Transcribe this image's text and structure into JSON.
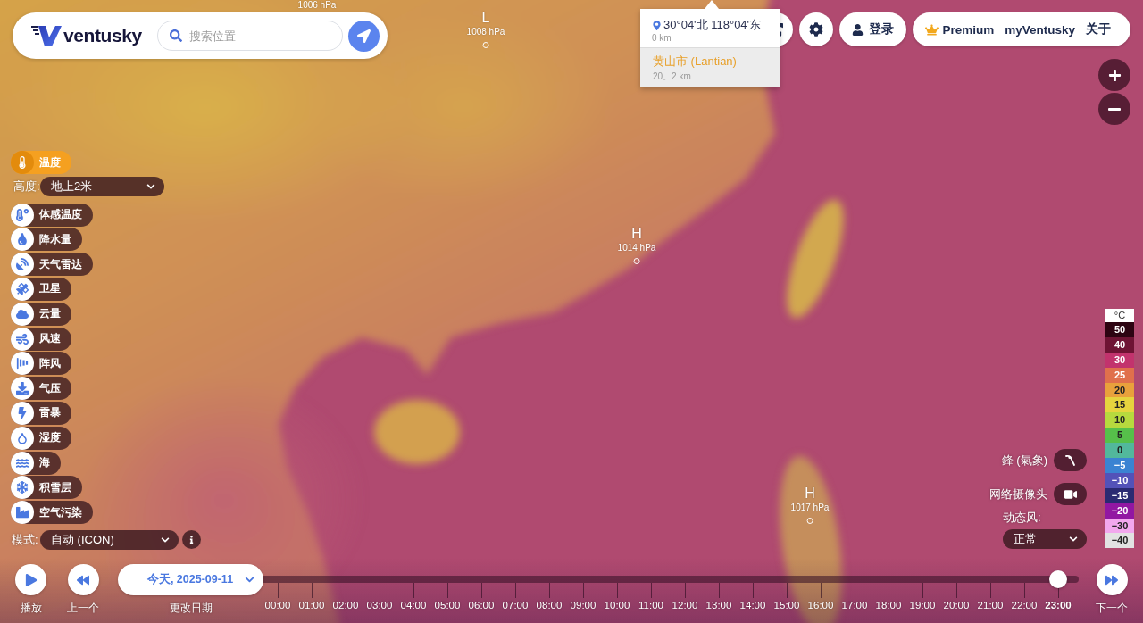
{
  "header": {
    "logo": "ventusky",
    "search": {
      "placeholder": "搜索位置"
    }
  },
  "location_popup": {
    "coordinates": "30°04'北 118°04'东",
    "elevation": "0 km",
    "place": "黄山市 (Lantian)",
    "place_detail": "20。2 km"
  },
  "account": {
    "login": "登录",
    "links": [
      "Premium",
      "myVentusky",
      "关于"
    ]
  },
  "pressure_centers": [
    {
      "reading": "1006 hPa"
    },
    {
      "letter": "L",
      "reading": "1008 hPa"
    },
    {
      "letter": "H",
      "reading": "1014 hPa"
    },
    {
      "letter": "H",
      "reading": "1017 hPa"
    }
  ],
  "layers": [
    {
      "label": "温度",
      "selected": true
    },
    {
      "label": "体感温度",
      "selected": false
    },
    {
      "label": "降水量",
      "selected": false
    },
    {
      "label": "天气雷达",
      "selected": false
    },
    {
      "label": "卫星",
      "selected": false
    },
    {
      "label": "云量",
      "selected": false
    },
    {
      "label": "风速",
      "selected": false
    },
    {
      "label": "阵风",
      "selected": false
    },
    {
      "label": "气压",
      "selected": false
    },
    {
      "label": "雷暴",
      "selected": false
    },
    {
      "label": "湿度",
      "selected": false
    },
    {
      "label": "海",
      "selected": false
    },
    {
      "label": "积雪层",
      "selected": false
    },
    {
      "label": "空气污染",
      "selected": false
    }
  ],
  "layer_options": {
    "label": "高度:",
    "value": "地上2米"
  },
  "model": {
    "label": "模式:",
    "value": "自动 (ICON)"
  },
  "overlays": [
    {
      "kind": "fronts",
      "label": "鋒 (氣象)"
    },
    {
      "kind": "webcam",
      "label": "网络摄像头"
    }
  ],
  "animated_wind": {
    "label": "动态风:",
    "value": "正常"
  },
  "legend": {
    "unit": "°C",
    "steps": [
      {
        "label": "50",
        "color": "#2d0412"
      },
      {
        "label": "40",
        "color": "#6e1434"
      },
      {
        "label": "30",
        "color": "#c2336d"
      },
      {
        "label": "25",
        "color": "#e0704c"
      },
      {
        "label": "20",
        "color": "#e9a13c"
      },
      {
        "label": "15",
        "color": "#e6d43e"
      },
      {
        "label": "10",
        "color": "#b7d93e"
      },
      {
        "label": "5",
        "color": "#56c04a"
      },
      {
        "label": "0",
        "color": "#52b89c"
      },
      {
        "label": "−5",
        "color": "#3b83d2"
      },
      {
        "label": "−10",
        "color": "#5352b8"
      },
      {
        "label": "−15",
        "color": "#2a2a72"
      },
      {
        "label": "−20",
        "color": "#9217a2"
      },
      {
        "label": "−30",
        "color": "#f2a8ee"
      },
      {
        "label": "−40",
        "color": "#e2e2e2"
      }
    ]
  },
  "timeline": {
    "play": "播放",
    "previous": "上一个",
    "date": "今天, 2025-09-11",
    "date_caption": "更改日期",
    "next": "下一个",
    "hours": [
      {
        "label": "00:00",
        "selected": false
      },
      {
        "label": "01:00",
        "selected": false
      },
      {
        "label": "02:00",
        "selected": false
      },
      {
        "label": "03:00",
        "selected": false
      },
      {
        "label": "04:00",
        "selected": false
      },
      {
        "label": "05:00",
        "selected": false
      },
      {
        "label": "06:00",
        "selected": false
      },
      {
        "label": "07:00",
        "selected": false
      },
      {
        "label": "08:00",
        "selected": false
      },
      {
        "label": "09:00",
        "selected": false
      },
      {
        "label": "10:00",
        "selected": false
      },
      {
        "label": "11:00",
        "selected": false
      },
      {
        "label": "12:00",
        "selected": false
      },
      {
        "label": "13:00",
        "selected": false
      },
      {
        "label": "14:00",
        "selected": false
      },
      {
        "label": "15:00",
        "selected": false
      },
      {
        "label": "16:00",
        "selected": false
      },
      {
        "label": "17:00",
        "selected": false
      },
      {
        "label": "18:00",
        "selected": false
      },
      {
        "label": "19:00",
        "selected": false
      },
      {
        "label": "20:00",
        "selected": false
      },
      {
        "label": "21:00",
        "selected": false
      },
      {
        "label": "22:00",
        "selected": false
      },
      {
        "label": "23:00",
        "selected": true
      }
    ]
  }
}
